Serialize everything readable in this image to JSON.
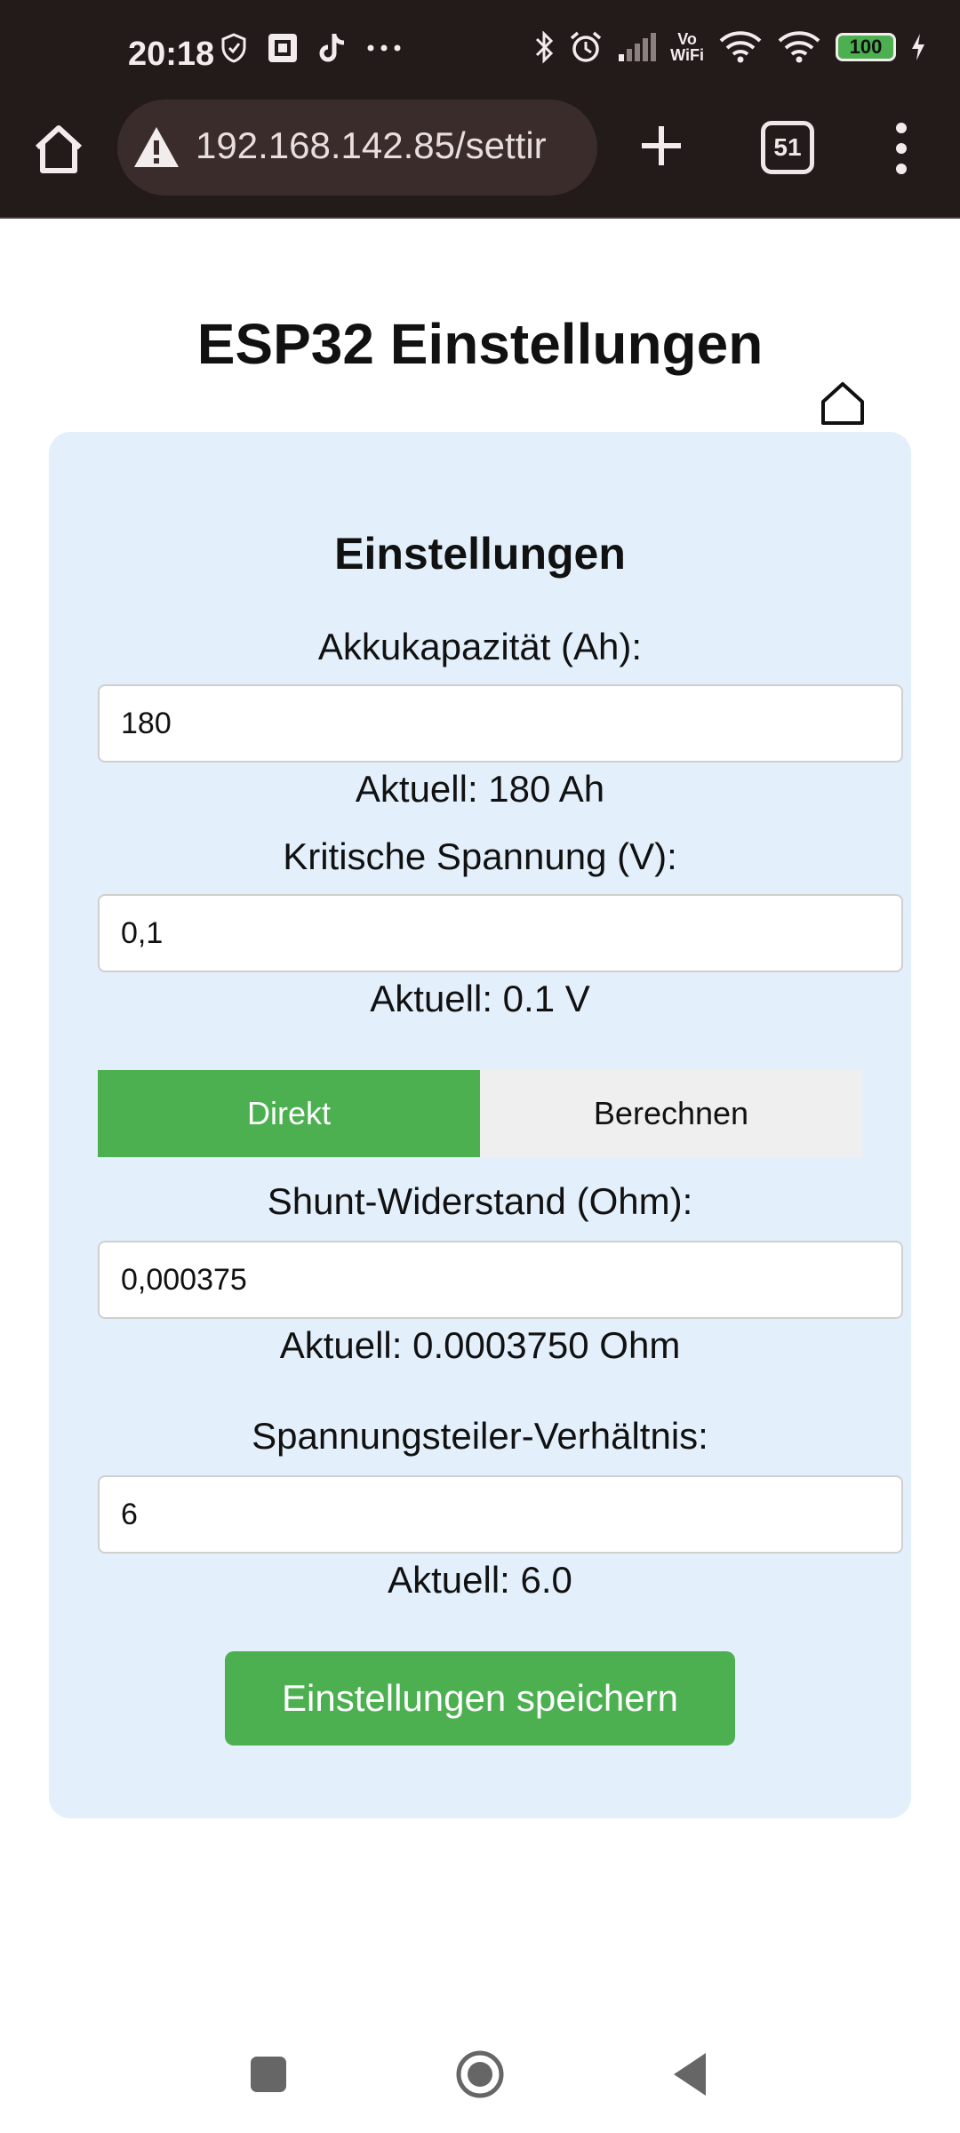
{
  "status_bar": {
    "time": "20:18",
    "left_icons": [
      "shield-icon",
      "scan-icon",
      "tiktok-icon",
      "more-dots-icon"
    ],
    "vowifi_top": "Vo",
    "vowifi_bottom": "WiFi",
    "battery": "100"
  },
  "browser": {
    "url": "192.168.142.85/settir",
    "tab_count": "51"
  },
  "page": {
    "title": "ESP32 Einstellungen"
  },
  "settings": {
    "heading": "Einstellungen",
    "capacity": {
      "label": "Akkukapazität (Ah):",
      "value": "180",
      "current": "Aktuell: 180 Ah"
    },
    "critical_voltage": {
      "label": "Kritische Spannung (V):",
      "value": "0,1",
      "current": "Aktuell: 0.1 V"
    },
    "mode_toggle": {
      "option_direct": "Direkt",
      "option_calculate": "Berechnen",
      "selected": "Direkt"
    },
    "shunt": {
      "label": "Shunt-Widerstand (Ohm):",
      "value": "0,000375",
      "current": "Aktuell: 0.0003750 Ohm"
    },
    "divider": {
      "label": "Spannungsteiler-Verhältnis:",
      "value": "6",
      "current": "Aktuell: 6.0"
    },
    "save_label": "Einstellungen speichern"
  },
  "colors": {
    "accent_green": "#4caf50",
    "card_bg": "#e3f0fb",
    "chrome_bg": "#231a1a"
  }
}
